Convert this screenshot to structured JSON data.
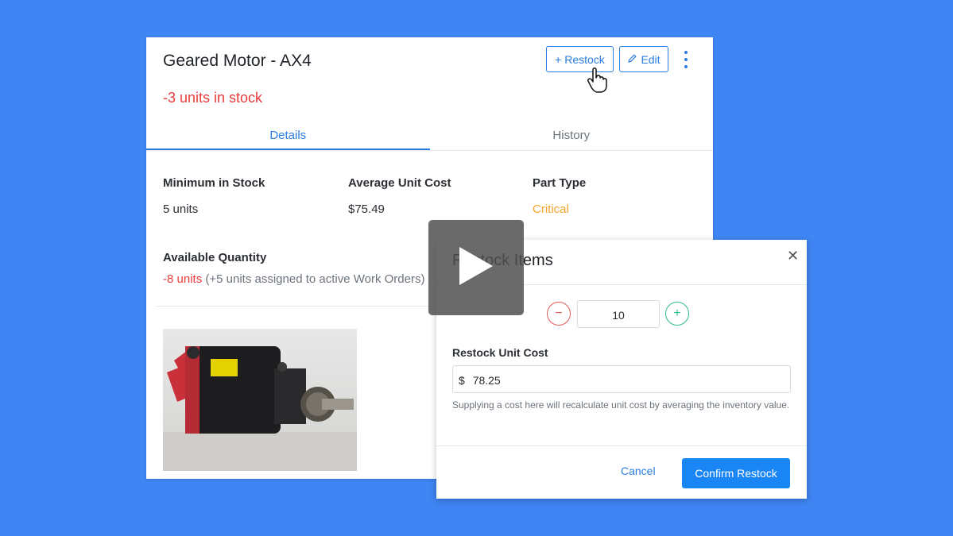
{
  "part": {
    "title": "Geared Motor - AX4",
    "stock_status": "-3 units in stock",
    "restock_label": "+ Restock",
    "edit_label": "Edit"
  },
  "tabs": [
    {
      "label": "Details",
      "active": true
    },
    {
      "label": "History",
      "active": false
    }
  ],
  "details": {
    "min_stock_label": "Minimum in Stock",
    "min_stock_value": "5 units",
    "avg_cost_label": "Average Unit Cost",
    "avg_cost_value": "$75.49",
    "part_type_label": "Part Type",
    "part_type_value": "Critical",
    "available_label": "Available Quantity",
    "available_value": "-8 units",
    "available_note": "(+5 units assigned to active Work Orders)"
  },
  "modal": {
    "title": "Restock Items",
    "quantity": "10",
    "cost_label": "Restock Unit Cost",
    "currency": "$",
    "cost_value": "78.25",
    "help_text": "Supplying a cost here will recalculate unit cost by averaging the inventory value.",
    "cancel_label": "Cancel",
    "confirm_label": "Confirm Restock"
  },
  "icons": {
    "edit": "pencil-icon",
    "more": "kebab-menu-icon",
    "close": "close-icon",
    "minus": "minus-icon",
    "plus": "plus-icon",
    "play": "play-icon",
    "cursor": "hand-cursor-icon"
  },
  "colors": {
    "background": "#3f85f3",
    "accent": "#2a7de1",
    "danger": "#ea3b3b",
    "warning": "#f2a52a",
    "success": "#2dbd8c"
  }
}
